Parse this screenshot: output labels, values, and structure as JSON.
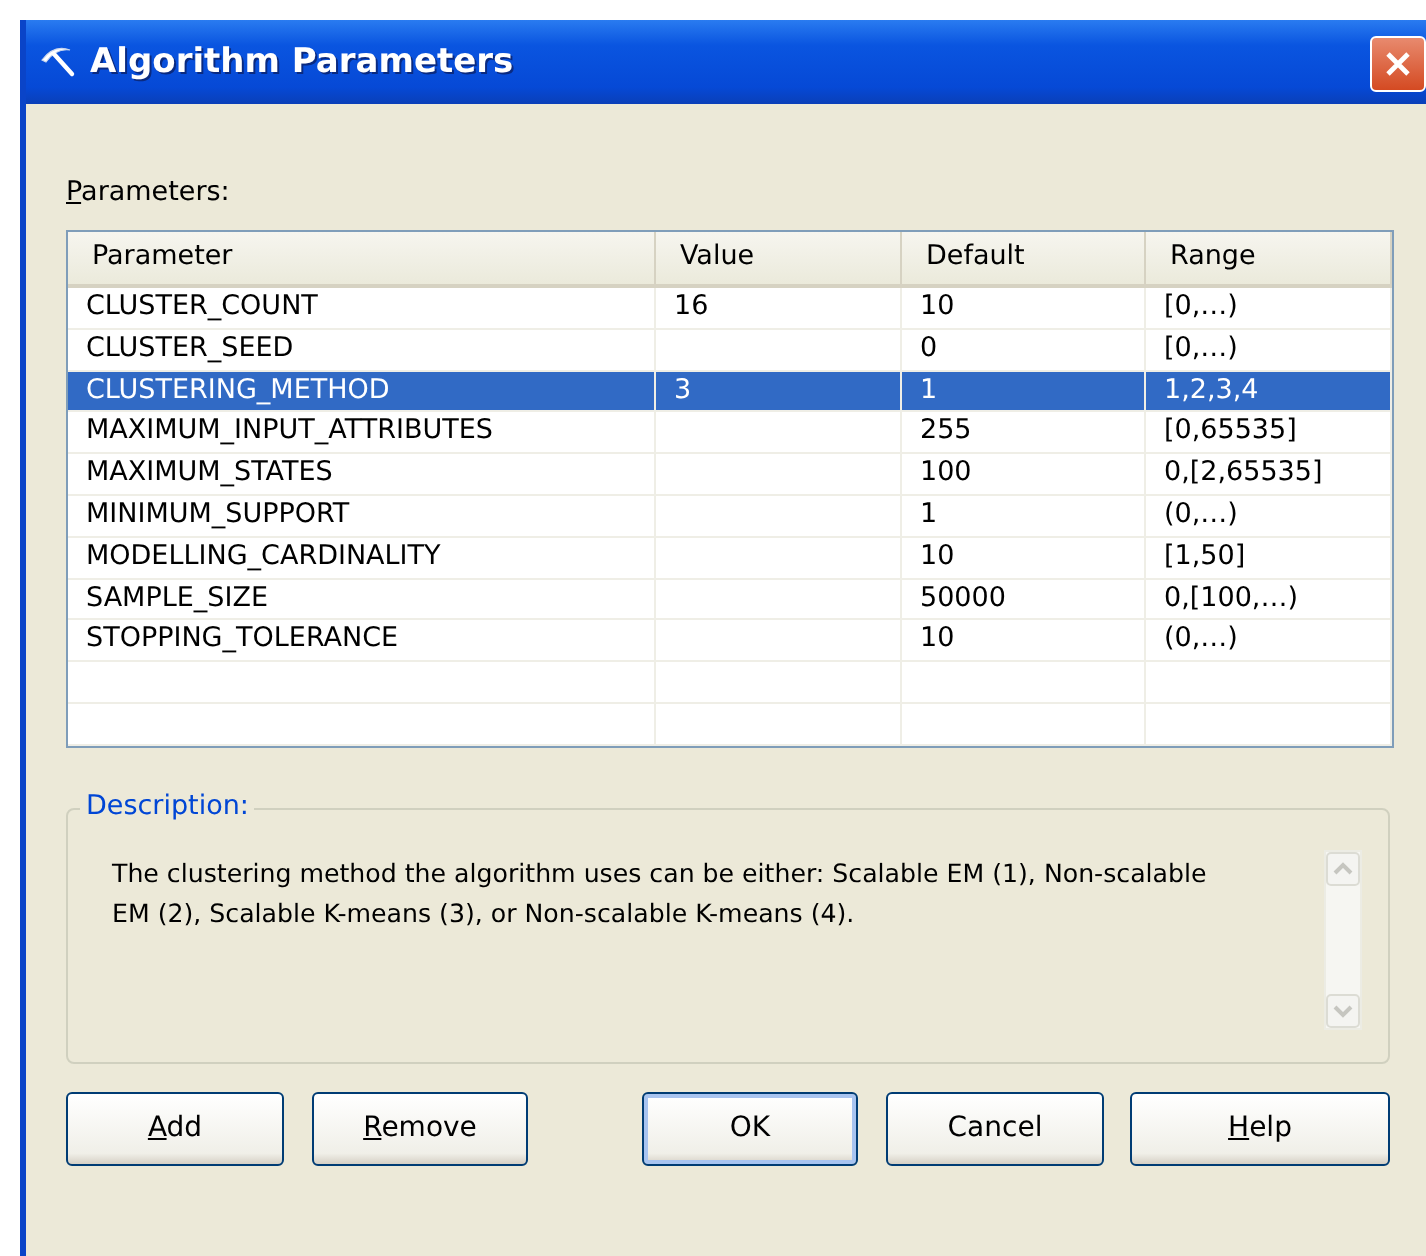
{
  "window": {
    "title": "Algorithm Parameters"
  },
  "parameters_label": {
    "text": "Parameters:",
    "underline_first": true
  },
  "table": {
    "columns": [
      "Parameter",
      "Value",
      "Default",
      "Range"
    ],
    "rows": [
      {
        "cells": [
          "CLUSTER_COUNT",
          "16",
          "10",
          "[0,…)"
        ],
        "selected": false
      },
      {
        "cells": [
          "CLUSTER_SEED",
          "",
          "0",
          "[0,…)"
        ],
        "selected": false
      },
      {
        "cells": [
          "CLUSTERING_METHOD",
          "3",
          "1",
          "1,2,3,4"
        ],
        "selected": true
      },
      {
        "cells": [
          "MAXIMUM_INPUT_ATTRIBUTES",
          "",
          "255",
          "[0,65535]"
        ],
        "selected": false
      },
      {
        "cells": [
          "MAXIMUM_STATES",
          "",
          "100",
          "0,[2,65535]"
        ],
        "selected": false
      },
      {
        "cells": [
          "MINIMUM_SUPPORT",
          "",
          "1",
          "(0,…)"
        ],
        "selected": false
      },
      {
        "cells": [
          "MODELLING_CARDINALITY",
          "",
          "10",
          "[1,50]"
        ],
        "selected": false
      },
      {
        "cells": [
          "SAMPLE_SIZE",
          "",
          "50000",
          "0,[100,…)"
        ],
        "selected": false
      },
      {
        "cells": [
          "STOPPING_TOLERANCE",
          "",
          "10",
          "(0,…)"
        ],
        "selected": false
      }
    ]
  },
  "description": {
    "label": "Description:",
    "text": "The clustering method the algorithm uses can be either: Scalable EM (1), Non-scalable EM (2), Scalable K-means (3), or Non-scalable K-means (4)."
  },
  "buttons": [
    {
      "label": "Add",
      "underline_first": true,
      "default": false
    },
    {
      "label": "Remove",
      "underline_first": true,
      "default": false
    },
    {
      "label": "OK",
      "underline_first": false,
      "default": true
    },
    {
      "label": "Cancel",
      "underline_first": false,
      "default": false
    },
    {
      "label": "Help",
      "underline_first": true,
      "default": false
    }
  ]
}
